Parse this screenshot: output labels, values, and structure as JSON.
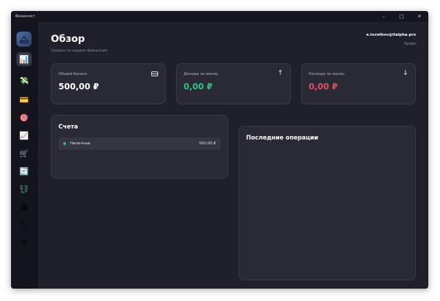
{
  "app": {
    "title": "Финансист"
  },
  "window_controls": {
    "minimize": "–",
    "maximize": "□",
    "close": "✕"
  },
  "sidebar": {
    "avatar_glyph": "🏔",
    "items": [
      {
        "name": "dashboard",
        "glyph": "📊",
        "active": true
      },
      {
        "name": "transactions",
        "glyph": "💸"
      },
      {
        "name": "cards",
        "glyph": "💳"
      },
      {
        "name": "goals",
        "glyph": "🎯"
      },
      {
        "name": "analytics",
        "glyph": "📈"
      },
      {
        "name": "shopping",
        "glyph": "🛒"
      },
      {
        "name": "subscriptions",
        "glyph": "🔄"
      },
      {
        "name": "currency",
        "glyph": "💱"
      },
      {
        "name": "storage",
        "glyph": "🏛"
      },
      {
        "name": "tags",
        "glyph": "🏷"
      },
      {
        "name": "settings",
        "glyph": "⚙"
      }
    ]
  },
  "header": {
    "title": "Обзор",
    "subtitle": "Сводка по вашим финансам",
    "user_email": "e.tsvetkov@italpha.pro",
    "user_plan": "Профи"
  },
  "stats": {
    "balance": {
      "label": "Общий баланс",
      "value": "500,00 ₽"
    },
    "income": {
      "label": "Доходы за месяц",
      "value": "0,00 ₽"
    },
    "expense": {
      "label": "Расходы за месяц",
      "value": "0,00 ₽"
    }
  },
  "colors": {
    "income": "#2ec27e",
    "expense": "#e0505a",
    "accent": "#2ec27e"
  },
  "accounts": {
    "title": "Счета",
    "items": [
      {
        "name": "Наличные",
        "amount": "500,00 ₽"
      }
    ]
  },
  "recent": {
    "title": "Последние операции"
  }
}
